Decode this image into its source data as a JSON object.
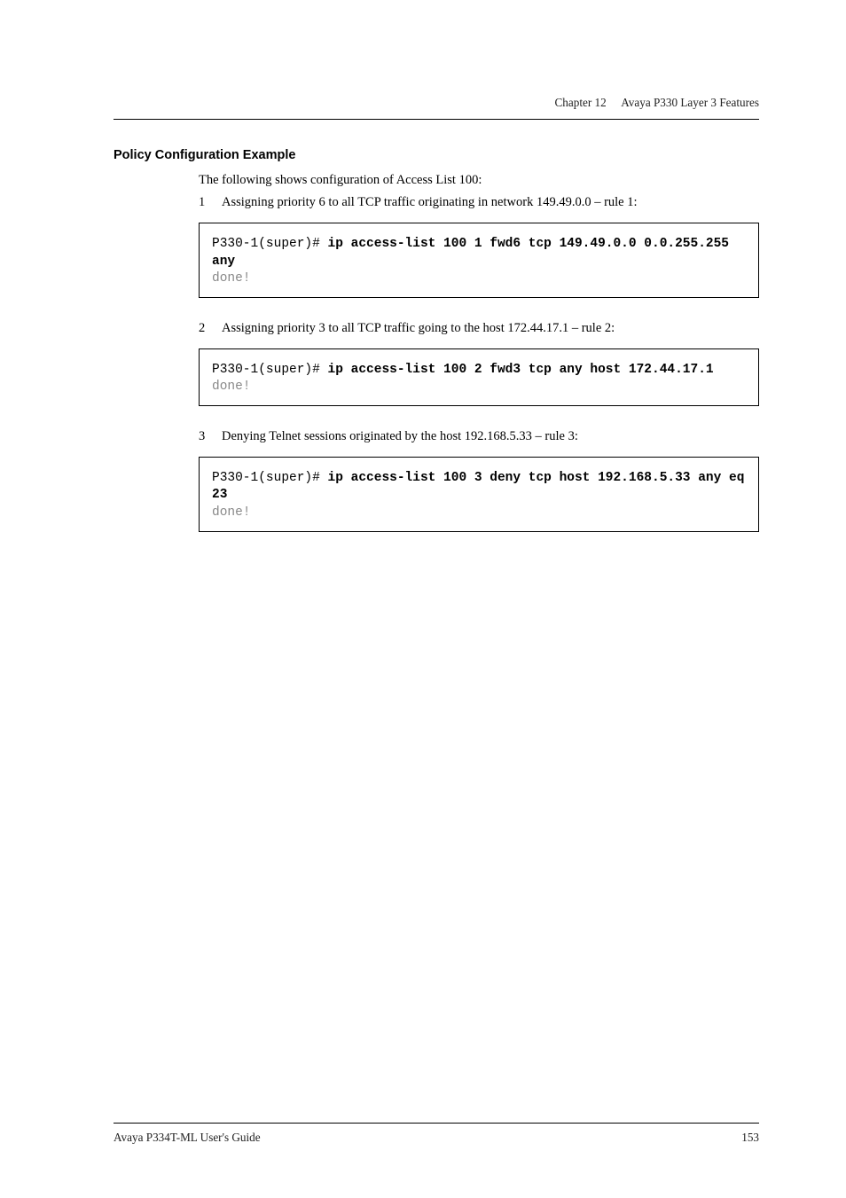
{
  "header": {
    "chapter": "Chapter 12",
    "title": "Avaya P330 Layer 3 Features"
  },
  "section": {
    "heading": "Policy Configuration Example",
    "intro": "The following shows configuration of Access List 100:",
    "items": [
      {
        "num": "1",
        "text": "Assigning priority 6 to all TCP traffic originating in network 149.49.0.0 – rule 1:",
        "code_prompt": "P330-1(super)# ",
        "code_bold": "ip access-list 100 1 fwd6 tcp 149.49.0.0 0.0.255.255 any",
        "code_output": "done!"
      },
      {
        "num": "2",
        "text": "Assigning priority 3 to all TCP traffic going to the host 172.44.17.1 – rule 2:",
        "code_prompt": "P330-1(super)# ",
        "code_bold": "ip access-list 100 2 fwd3 tcp any host 172.44.17.1",
        "code_output": "done!"
      },
      {
        "num": "3",
        "text": "Denying Telnet sessions originated by the host 192.168.5.33 – rule 3:",
        "code_prompt": "P330-1(super)# ",
        "code_bold": "ip access-list 100 3 deny tcp host 192.168.5.33 any eq 23",
        "code_output": "done!"
      }
    ]
  },
  "footer": {
    "left": "Avaya P334T-ML User's Guide",
    "right": "153"
  }
}
